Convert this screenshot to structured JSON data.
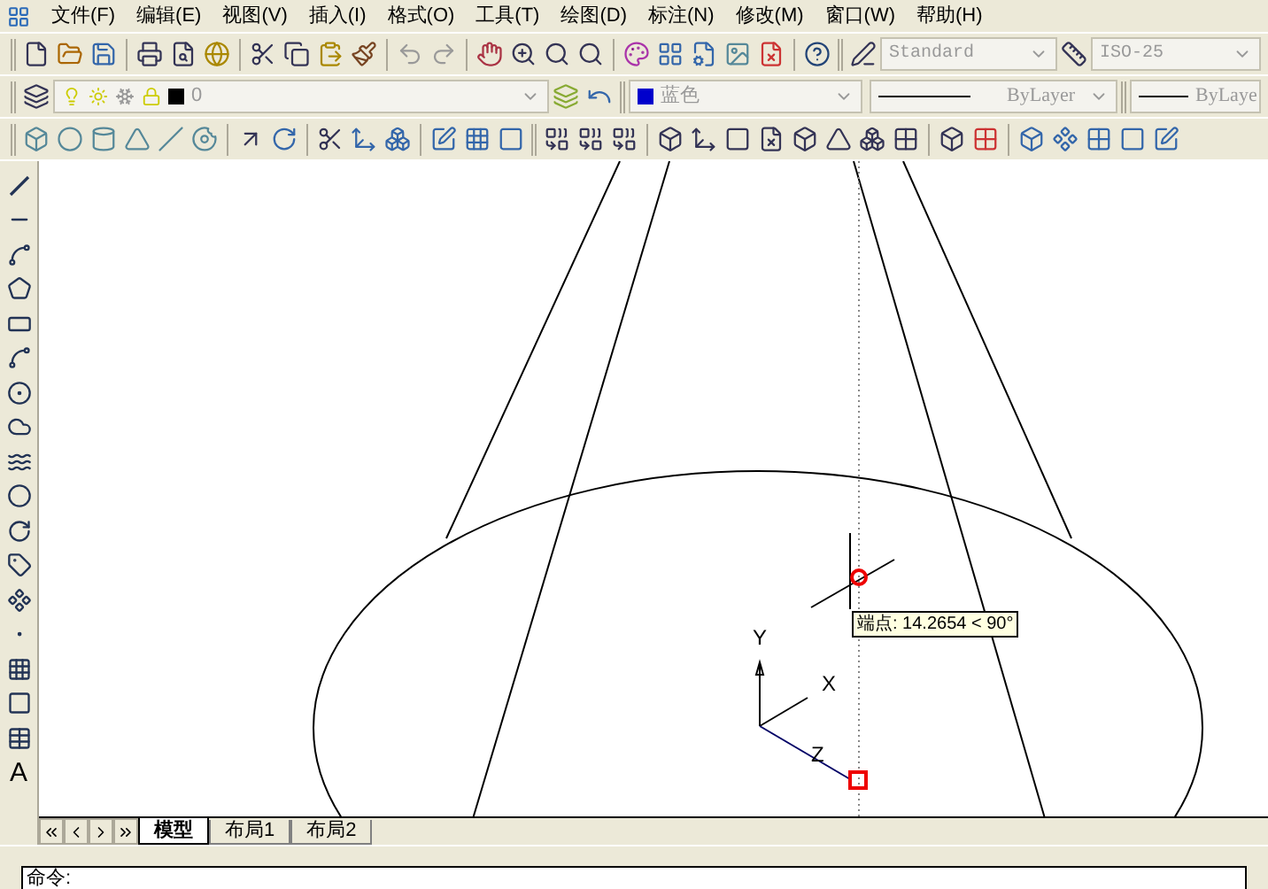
{
  "menu_bar": {
    "items": [
      "文件(F)",
      "编辑(E)",
      "视图(V)",
      "插入(I)",
      "格式(O)",
      "工具(T)",
      "绘图(D)",
      "标注(N)",
      "修改(M)",
      "窗口(W)",
      "帮助(H)"
    ]
  },
  "styles_toolbar": {
    "text_style": "Standard",
    "dimension_style": "ISO-25"
  },
  "layers_toolbar": {
    "layer": "0"
  },
  "properties_toolbar": {
    "color": {
      "label": "蓝色",
      "color": "#0000cc"
    },
    "linetype": "ByLayer",
    "lineweight": "ByLaye"
  },
  "draw_toolbar": {
    "text_tool_glyph": "A"
  },
  "canvas": {
    "tooltip": "端点: 14.2654 < 90°",
    "ucs_labels": {
      "x": "X",
      "y": "Y",
      "z": "Z"
    }
  },
  "layout_tabs": [
    {
      "label": "模型",
      "selected": true
    },
    {
      "label": "布局1",
      "selected": false
    },
    {
      "label": "布局2",
      "selected": false
    }
  ],
  "command_line": {
    "prompt": "命令:"
  }
}
